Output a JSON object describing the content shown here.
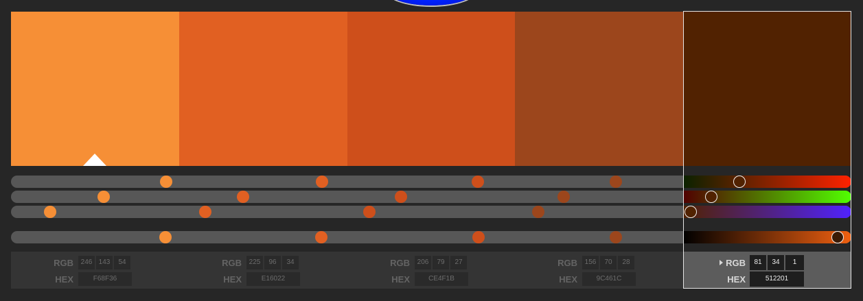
{
  "palette": {
    "swatches": [
      {
        "hex": "F68F36",
        "rgb": [
          "246",
          "143",
          "54"
        ],
        "color": "#f68f36",
        "selected": false
      },
      {
        "hex": "E16022",
        "rgb": [
          "225",
          "96",
          "34"
        ],
        "color": "#e16022",
        "selected": false
      },
      {
        "hex": "CE4F1B",
        "rgb": [
          "206",
          "79",
          "27"
        ],
        "color": "#ce4f1b",
        "selected": false
      },
      {
        "hex": "9C461C",
        "rgb": [
          "156",
          "70",
          "28"
        ],
        "color": "#9c461c",
        "selected": false
      },
      {
        "hex": "512201",
        "rgb": [
          "81",
          "34",
          "1"
        ],
        "color": "#512201",
        "selected": true
      }
    ]
  },
  "info": {
    "rgb_label": "RGB",
    "hex_label": "HEX"
  },
  "sliders": {
    "channels": [
      "red",
      "green",
      "blue",
      "brightness"
    ],
    "selected_levels": {
      "red": 0.32,
      "green": 0.13,
      "blue": 0.0,
      "brightness": 0.91
    }
  }
}
